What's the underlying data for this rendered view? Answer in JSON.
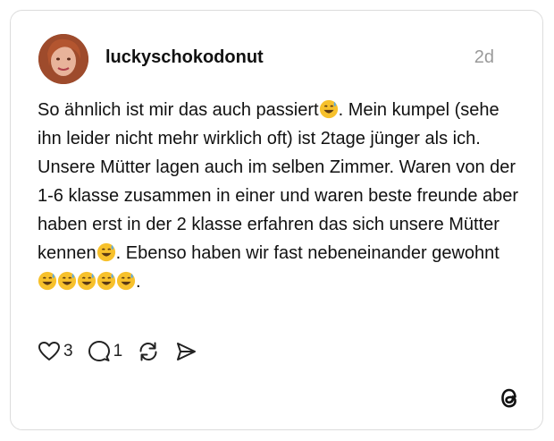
{
  "post": {
    "username": "luckyschokodonut",
    "time": "2d",
    "text_1": "So ähnlich ist mir das auch passiert",
    "text_2": ". Mein kumpel (sehe ihn leider nicht mehr wirklich oft) ist 2tage jünger als ich. Unsere Mütter lagen auch im selben Zimmer. Waren von der 1-6 klasse zusammen in einer und waren beste freunde aber haben erst in der 2 klasse erfahren das sich unsere Mütter kennen",
    "text_3": ". Ebenso haben wir fast nebeneinander gewohnt ",
    "text_4": ".",
    "emoji": "grinning-face-with-sweat"
  },
  "actions": {
    "likes": "3",
    "replies": "1",
    "icons": [
      "heart-icon",
      "comment-icon",
      "repost-icon",
      "share-icon"
    ]
  },
  "brand": {
    "logo": "threads-logo"
  }
}
